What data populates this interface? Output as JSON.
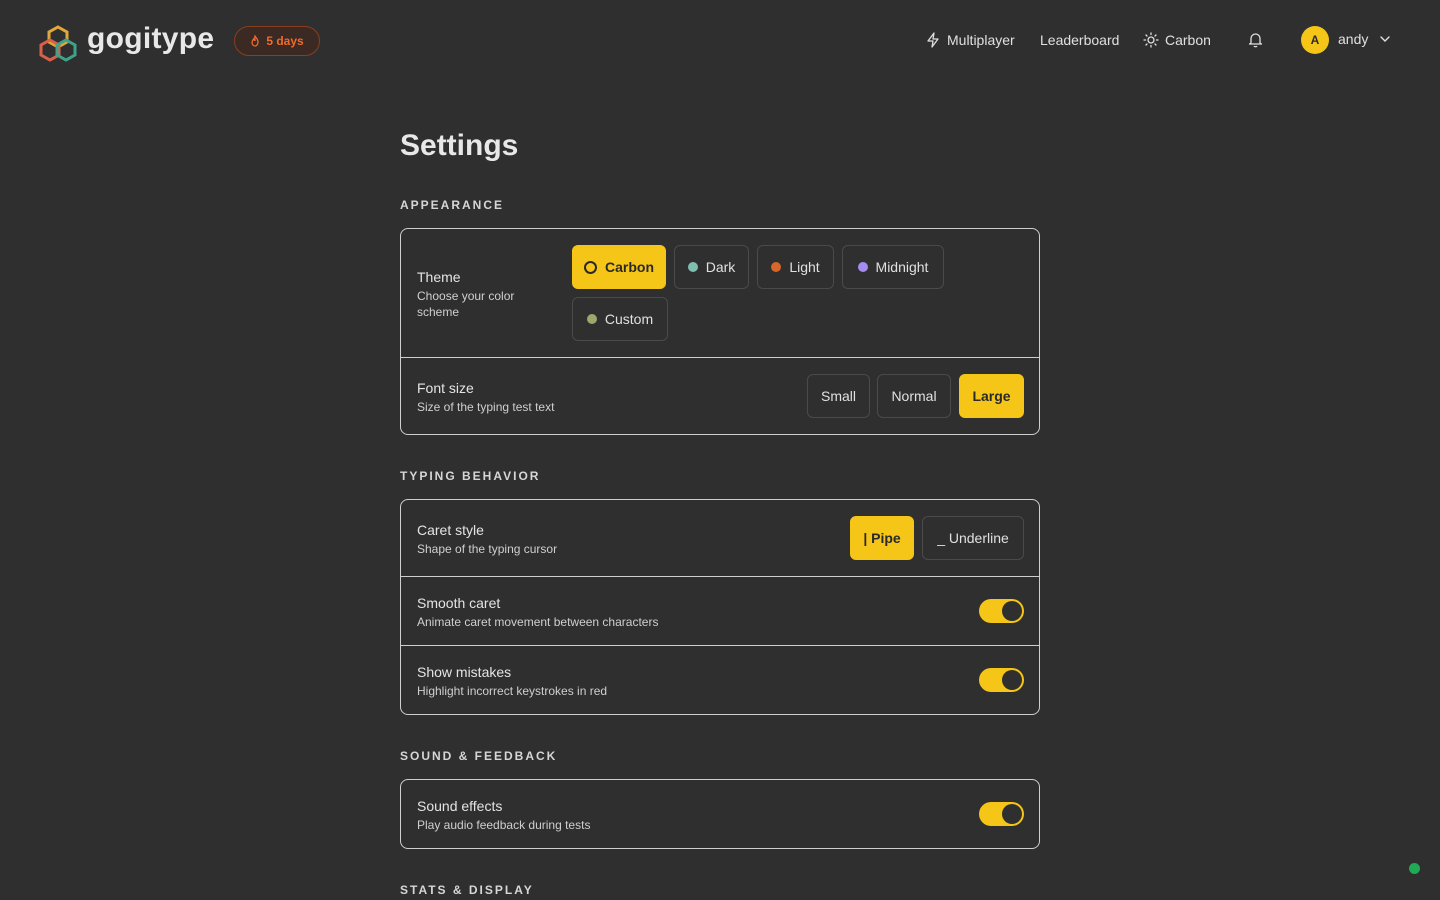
{
  "header": {
    "brand": "gogitype",
    "streak": "5 days",
    "nav": {
      "multiplayer": "Multiplayer",
      "leaderboard": "Leaderboard",
      "theme": "Carbon"
    },
    "user": {
      "initial": "A",
      "name": "andy"
    }
  },
  "page": {
    "title": "Settings"
  },
  "appearance": {
    "label": "APPEARANCE",
    "theme": {
      "title": "Theme",
      "desc_line1": "Choose your color",
      "desc_line2": "scheme",
      "options": [
        {
          "label": "Carbon",
          "color": "#f5c518",
          "selected": true
        },
        {
          "label": "Dark",
          "color": "#7fbfb0",
          "selected": false
        },
        {
          "label": "Light",
          "color": "#d9662a",
          "selected": false
        },
        {
          "label": "Midnight",
          "color": "#a48cf0",
          "selected": false
        },
        {
          "label": "Custom",
          "color": "#9aa86a",
          "selected": false
        }
      ]
    },
    "font_size": {
      "title": "Font size",
      "desc": "Size of the typing test text",
      "options": [
        "Small",
        "Normal",
        "Large"
      ],
      "selected": "Large"
    }
  },
  "typing": {
    "label": "TYPING BEHAVIOR",
    "caret_style": {
      "title": "Caret style",
      "desc": "Shape of the typing cursor",
      "options": [
        "| Pipe",
        "_ Underline"
      ],
      "selected": "| Pipe"
    },
    "smooth_caret": {
      "title": "Smooth caret",
      "desc": "Animate caret movement between characters",
      "on": true
    },
    "show_mistakes": {
      "title": "Show mistakes",
      "desc": "Highlight incorrect keystrokes in red",
      "on": true
    }
  },
  "sound": {
    "label": "SOUND & FEEDBACK",
    "sound_effects": {
      "title": "Sound effects",
      "desc": "Play audio feedback during tests",
      "on": true
    }
  },
  "stats": {
    "label": "STATS & DISPLAY"
  },
  "colors": {
    "accent": "#f5c518",
    "background": "#2f2f2f",
    "streak": "#f06a2a",
    "online": "#1faa55"
  }
}
